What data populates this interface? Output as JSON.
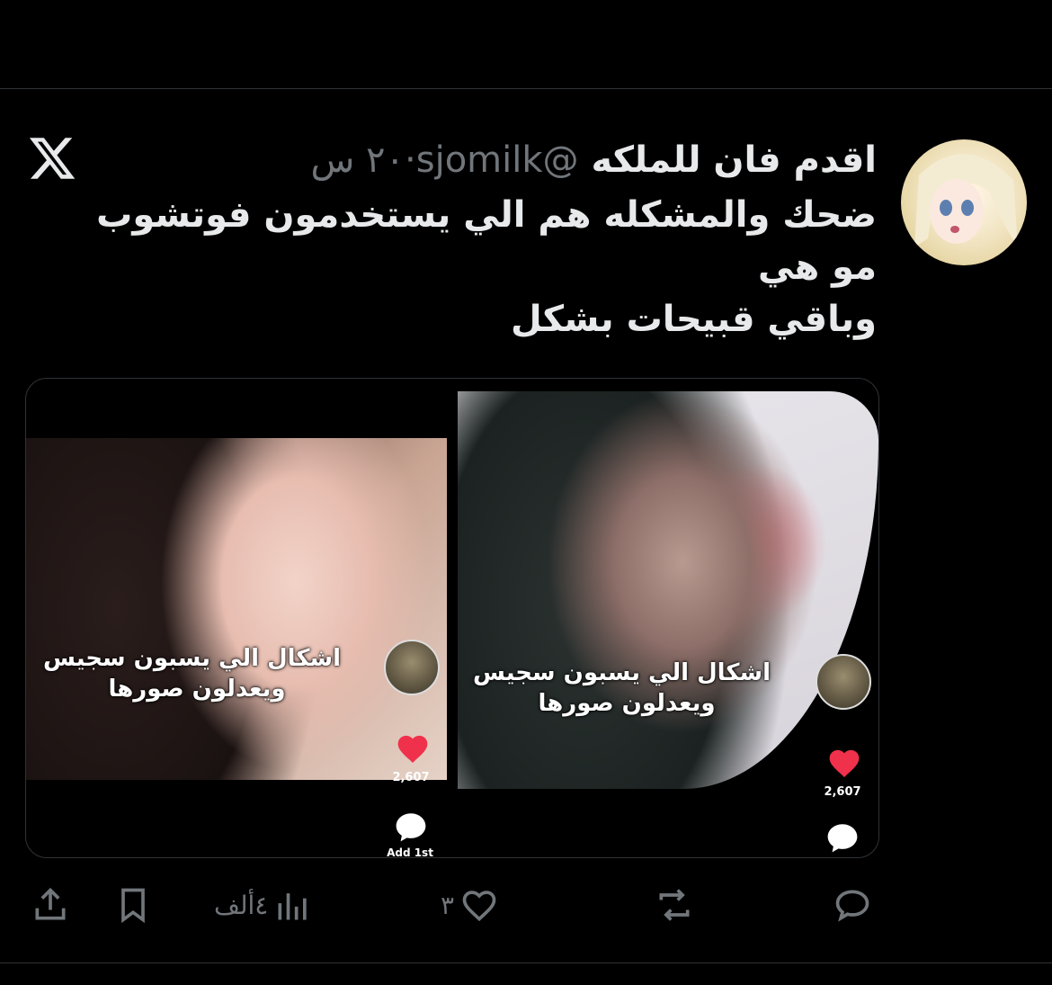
{
  "tweet": {
    "display_name": "اقدم فان للملكه",
    "handle": "@sjomilk",
    "time": "٢٠ س",
    "lines": [
      "ضحك والمشكله هم الي يستخدمون فوتشوب",
      "مو هي",
      "وباقي قبيحات بشكل"
    ]
  },
  "media": {
    "left": {
      "overlay_line1": "اشكال الي يسبون سجيس",
      "overlay_line2": "ويعدلون صورها",
      "likes": "2,607",
      "comment_label": "Add 1st"
    },
    "right": {
      "overlay_line1": "اشكال الي يسبون سجيس",
      "overlay_line2": "ويعدلون صورها",
      "likes": "2,607"
    }
  },
  "actions": {
    "likes": "٣",
    "views": "٤ألف"
  },
  "icons": [
    "x-logo-icon",
    "heart-icon",
    "comment-icon",
    "reply-icon",
    "retweet-icon",
    "like-icon",
    "views-icon",
    "bookmark-icon",
    "share-icon"
  ],
  "colors": {
    "background": "#000000",
    "text": "#e7e9ea",
    "muted": "#71767b",
    "heart": "#f0314b"
  }
}
